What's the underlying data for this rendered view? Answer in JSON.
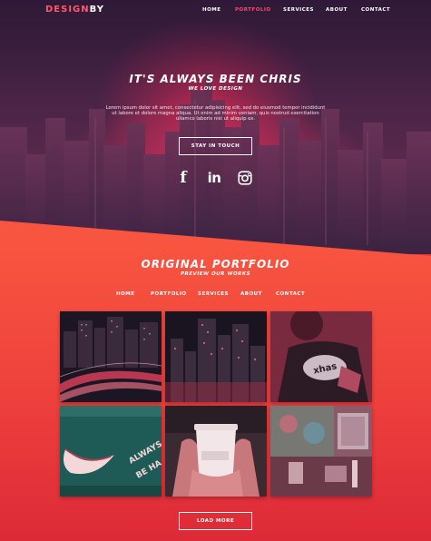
{
  "brand": {
    "part1": "DESIGN",
    "part2": "BY",
    "accent": "#ff5a6a"
  },
  "top_nav": {
    "items": [
      {
        "label": "HOME",
        "active": false
      },
      {
        "label": "PORTFOLIO",
        "active": true
      },
      {
        "label": "SERVICES",
        "active": false
      },
      {
        "label": "ABOUT",
        "active": false
      },
      {
        "label": "CONTACT",
        "active": false
      }
    ]
  },
  "hero": {
    "title": "IT'S ALWAYS BEEN CHRIS",
    "subtitle": "WE LOVE DESIGN",
    "body": "Lorem ipsum dolor sit amet, consectetur adipisicing elit, sed do eiusmod tempor incididunt ut labore et dolore magna aliqua. Ut enim ad minim veniam, quis nostrud exercitation ullamco laboris nisi ut aliquip ex.",
    "cta_label": "STAY IN TOUCH",
    "social": [
      {
        "icon": "facebook-icon",
        "glyph": "f"
      },
      {
        "icon": "linkedin-icon",
        "glyph": "in"
      },
      {
        "icon": "instagram-icon",
        "glyph": ""
      }
    ]
  },
  "portfolio": {
    "title": "ORIGINAL PORTFOLIO",
    "subtitle": "PREVIEW OUR WORKS",
    "nav": [
      "HOME",
      "PORTFOLIO",
      "SERVICES",
      "ABOUT",
      "CONTACT"
    ],
    "tiles": [
      {
        "name": "city-highway-night"
      },
      {
        "name": "city-aerial-night"
      },
      {
        "name": "person-tshirt"
      },
      {
        "name": "graffiti-wall",
        "text": "ALWAYS BE HAPPY"
      },
      {
        "name": "coffee-cup"
      },
      {
        "name": "art-studio"
      }
    ],
    "load_more_label": "LOAD MORE"
  },
  "colors": {
    "hero_dark": "#3a1f3e",
    "portfolio_orange": "#f85540",
    "portfolio_red": "#dd2a38"
  }
}
